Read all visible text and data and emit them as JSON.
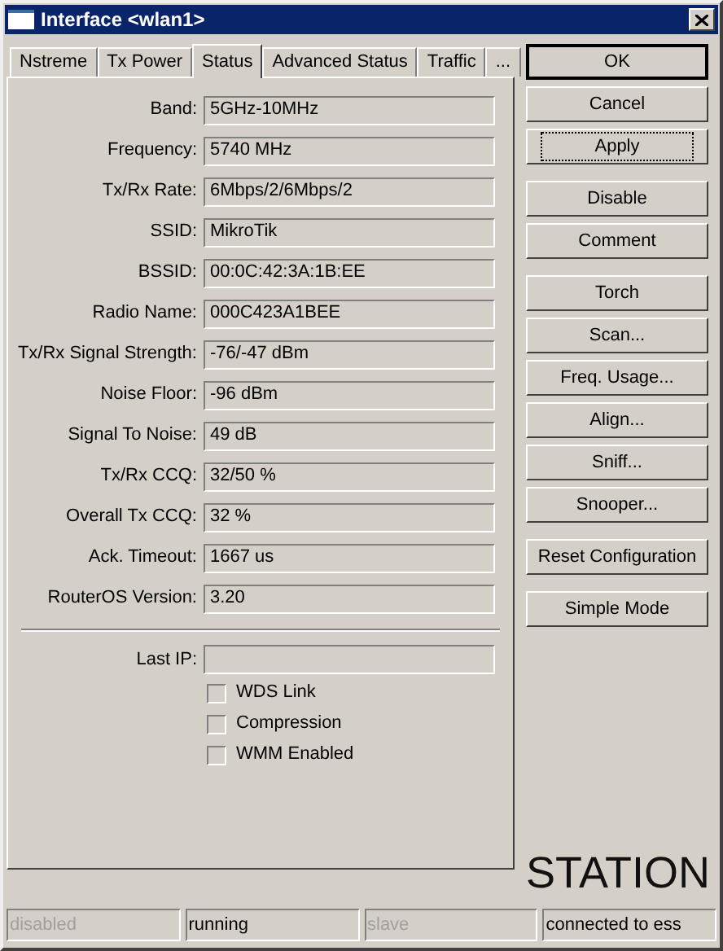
{
  "window": {
    "title": "Interface <wlan1>"
  },
  "tabs": [
    {
      "label": "Nstreme",
      "selected": false
    },
    {
      "label": "Tx Power",
      "selected": false
    },
    {
      "label": "Status",
      "selected": true
    },
    {
      "label": "Advanced Status",
      "selected": false
    },
    {
      "label": "Traffic",
      "selected": false
    },
    {
      "label": "...",
      "selected": false
    }
  ],
  "fields": [
    {
      "label": "Band:",
      "value": "5GHz-10MHz"
    },
    {
      "label": "Frequency:",
      "value": "5740 MHz"
    },
    {
      "label": "Tx/Rx Rate:",
      "value": "6Mbps/2/6Mbps/2"
    },
    {
      "label": "SSID:",
      "value": "MikroTik"
    },
    {
      "label": "BSSID:",
      "value": "00:0C:42:3A:1B:EE"
    },
    {
      "label": "Radio Name:",
      "value": "000C423A1BEE"
    },
    {
      "label": "Tx/Rx Signal Strength:",
      "value": "-76/-47 dBm"
    },
    {
      "label": "Noise Floor:",
      "value": "-96 dBm"
    },
    {
      "label": "Signal To Noise:",
      "value": "49 dB"
    },
    {
      "label": "Tx/Rx CCQ:",
      "value": "32/50 %"
    },
    {
      "label": "Overall Tx CCQ:",
      "value": "32 %"
    },
    {
      "label": "Ack. Timeout:",
      "value": "1667 us"
    },
    {
      "label": "RouterOS Version:",
      "value": "3.20"
    }
  ],
  "last_ip": {
    "label": "Last IP:"
  },
  "checkboxes": [
    {
      "label": "WDS Link",
      "checked": false
    },
    {
      "label": "Compression",
      "checked": false
    },
    {
      "label": "WMM Enabled",
      "checked": false
    }
  ],
  "button_groups": [
    [
      {
        "label": "OK",
        "default": true,
        "focused": false
      },
      {
        "label": "Cancel",
        "default": false,
        "focused": false
      },
      {
        "label": "Apply",
        "default": false,
        "focused": true
      }
    ],
    [
      {
        "label": "Disable",
        "default": false,
        "focused": false
      },
      {
        "label": "Comment",
        "default": false,
        "focused": false
      }
    ],
    [
      {
        "label": "Torch",
        "default": false,
        "focused": false
      },
      {
        "label": "Scan...",
        "default": false,
        "focused": false
      },
      {
        "label": "Freq. Usage...",
        "default": false,
        "focused": false
      },
      {
        "label": "Align...",
        "default": false,
        "focused": false
      },
      {
        "label": "Sniff...",
        "default": false,
        "focused": false
      },
      {
        "label": "Snooper...",
        "default": false,
        "focused": false
      }
    ],
    [
      {
        "label": "Reset Configuration",
        "default": false,
        "focused": false
      }
    ],
    [
      {
        "label": "Simple Mode",
        "default": false,
        "focused": false
      }
    ]
  ],
  "mode_label": "STATION",
  "status_bar": [
    {
      "text": "disabled",
      "disabled": true
    },
    {
      "text": "running",
      "disabled": false
    },
    {
      "text": "slave",
      "disabled": true
    },
    {
      "text": "connected to ess",
      "disabled": false
    }
  ]
}
